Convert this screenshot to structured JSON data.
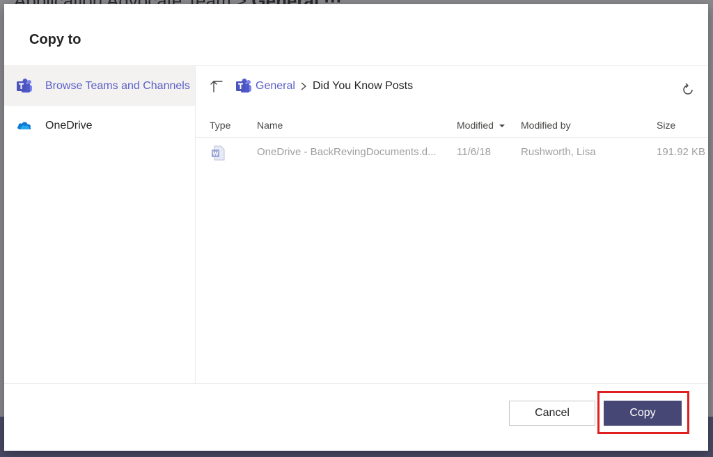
{
  "background": {
    "title": "Application Advocate Team",
    "channel": "General ···"
  },
  "dialog": {
    "title": "Copy to"
  },
  "nav": {
    "items": [
      {
        "label": "Browse Teams and Channels",
        "icon": "teams-icon",
        "active": true
      },
      {
        "label": "OneDrive",
        "icon": "onedrive-icon",
        "active": false
      }
    ]
  },
  "breadcrumb": {
    "root": "General",
    "current": "Did You Know Posts"
  },
  "table": {
    "headers": {
      "type": "Type",
      "name": "Name",
      "modified": "Modified",
      "modified_by": "Modified by",
      "size": "Size"
    },
    "rows": [
      {
        "icon": "word-file-icon",
        "name": "OneDrive - BackRevingDocuments.d...",
        "modified": "11/6/18",
        "modified_by": "Rushworth, Lisa",
        "size": "191.92 KB"
      }
    ]
  },
  "footer": {
    "cancel_label": "Cancel",
    "copy_label": "Copy"
  },
  "colors": {
    "accent": "#5b5fc7",
    "primary_button": "#464775",
    "highlight": "#e02020"
  }
}
